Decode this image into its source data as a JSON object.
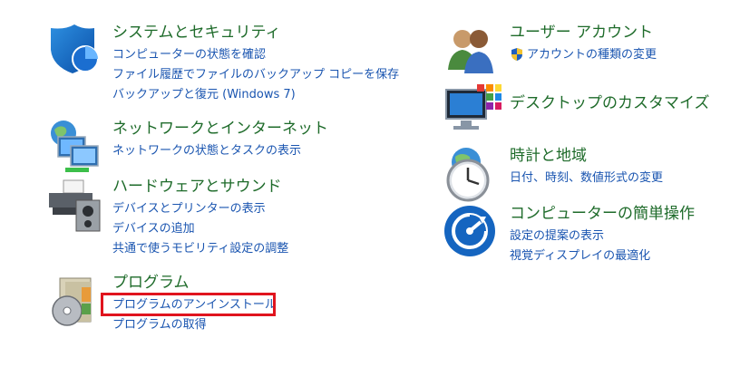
{
  "left": [
    {
      "id": "system-security",
      "title": "システムとセキュリティ",
      "links": [
        "コンピューターの状態を確認",
        "ファイル履歴でファイルのバックアップ コピーを保存",
        "バックアップと復元 (Windows 7)"
      ]
    },
    {
      "id": "network-internet",
      "title": "ネットワークとインターネット",
      "links": [
        "ネットワークの状態とタスクの表示"
      ]
    },
    {
      "id": "hardware-sound",
      "title": "ハードウェアとサウンド",
      "links": [
        "デバイスとプリンターの表示",
        "デバイスの追加",
        "共通で使うモビリティ設定の調整"
      ]
    },
    {
      "id": "programs",
      "title": "プログラム",
      "links": [
        "プログラムのアンインストール",
        "プログラムの取得"
      ]
    }
  ],
  "right": [
    {
      "id": "user-accounts",
      "title": "ユーザー アカウント",
      "links": [
        "アカウントの種類の変更"
      ]
    },
    {
      "id": "appearance",
      "title": "デスクトップのカスタマイズ",
      "links": []
    },
    {
      "id": "clock-region",
      "title": "時計と地域",
      "links": [
        "日付、時刻、数値形式の変更"
      ]
    },
    {
      "id": "ease-of-access",
      "title": "コンピューターの簡単操作",
      "links": [
        "設定の提案の表示",
        "視覚ディスプレイの最適化"
      ]
    }
  ],
  "colors": {
    "title": "#1e6b2a",
    "link": "#1a55b0",
    "highlight": "#e0141e"
  }
}
